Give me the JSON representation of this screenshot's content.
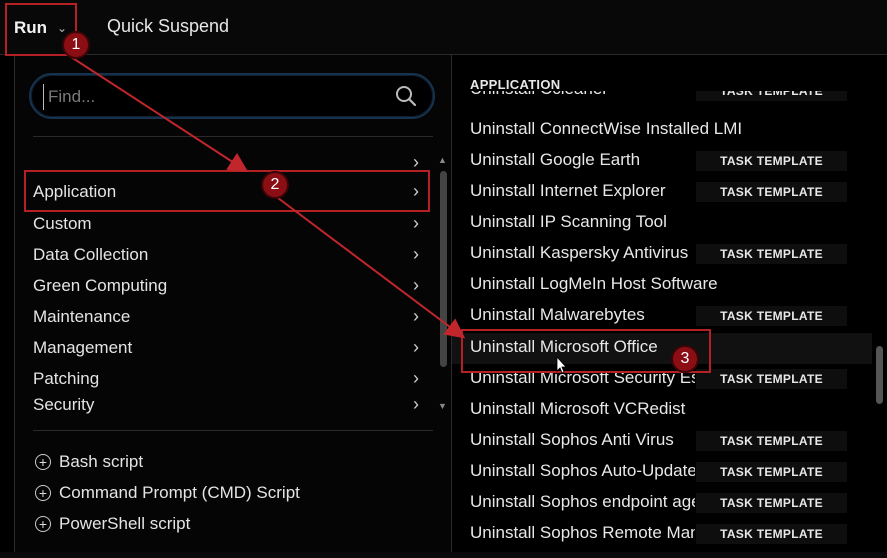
{
  "topbar": {
    "run_label": "Run",
    "quick_suspend": "Quick Suspend"
  },
  "search": {
    "placeholder": "Find..."
  },
  "categories": [
    {
      "label": ""
    },
    {
      "label": "Application"
    },
    {
      "label": "Custom"
    },
    {
      "label": "Data Collection"
    },
    {
      "label": "Green Computing"
    },
    {
      "label": "Maintenance"
    },
    {
      "label": "Management"
    },
    {
      "label": "Patching"
    },
    {
      "label": "Security"
    }
  ],
  "scripts": [
    {
      "label": "Bash script"
    },
    {
      "label": "Command Prompt (CMD) Script"
    },
    {
      "label": "PowerShell script"
    }
  ],
  "right": {
    "title": "APPLICATION",
    "badge": "TASK TEMPLATE",
    "items": [
      {
        "label": "Uninstall Ccleaner",
        "badge": true
      },
      {
        "label": "Uninstall ConnectWise Installed LMI",
        "badge": false
      },
      {
        "label": "Uninstall Google Earth",
        "badge": true
      },
      {
        "label": "Uninstall Internet Explorer",
        "badge": true
      },
      {
        "label": "Uninstall IP Scanning Tool",
        "badge": false
      },
      {
        "label": "Uninstall Kaspersky Antivirus",
        "badge": true
      },
      {
        "label": "Uninstall LogMeIn Host Software",
        "badge": false
      },
      {
        "label": "Uninstall Malwarebytes",
        "badge": true
      },
      {
        "label": "Uninstall Microsoft Office",
        "badge": false
      },
      {
        "label": "Uninstall Microsoft Security Essentials",
        "badge": true
      },
      {
        "label": "Uninstall Microsoft VCRedist",
        "badge": false
      },
      {
        "label": "Uninstall Sophos Anti Virus",
        "badge": true
      },
      {
        "label": "Uninstall Sophos Auto-Update",
        "badge": true
      },
      {
        "label": "Uninstall Sophos endpoint agent",
        "badge": true
      },
      {
        "label": "Uninstall Sophos Remote Management",
        "badge": true
      }
    ]
  },
  "annotations": {
    "step1": "1",
    "step2": "2",
    "step3": "3"
  },
  "colors": {
    "annotation_red": "#b52025",
    "focus_blue": "#16324d"
  }
}
